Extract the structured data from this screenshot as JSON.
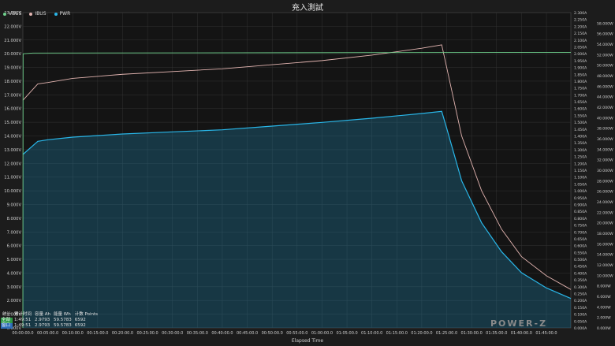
{
  "chart_data": {
    "type": "line",
    "title": "充入測試",
    "xlabel": "Elapsed Time",
    "x_ticks": [
      "00:00:00.0",
      "00:05:00.0",
      "00:10:00.0",
      "00:15:00.0",
      "00:20:00.0",
      "00:25:00.0",
      "00:30:00.0",
      "00:35:00.0",
      "00:40:00.0",
      "00:45:00.0",
      "00:50:00.0",
      "00:55:00.0",
      "01:00:00.0",
      "01:05:00.0",
      "01:10:00.0",
      "01:15:00.0",
      "01:20:00.0",
      "01:25:00.0",
      "01:30:00.0",
      "01:35:00.0",
      "01:40:00.0",
      "01:45:00.0"
    ],
    "x_unit": "minutes",
    "xlim": [
      0,
      109.9
    ],
    "y_left": {
      "name": "VBUS",
      "unit": "V",
      "ylim": [
        0,
        23
      ]
    },
    "y_mid": {
      "name": "IBUS",
      "unit": "A",
      "ylim": [
        0,
        2.3
      ]
    },
    "y_right": {
      "name": "PWR",
      "unit": "W",
      "ylim": [
        0,
        60
      ]
    },
    "legend": [
      "VBUS",
      "IBUS",
      "PWR"
    ],
    "legend_placement": "top-left",
    "grid": true,
    "series": [
      {
        "name": "VBUS",
        "unit": "V",
        "color": "#6fd08c",
        "x": [
          0,
          0.05,
          0.1,
          2,
          109.9
        ],
        "y": [
          0,
          20.0,
          20.0,
          20.05,
          20.1
        ]
      },
      {
        "name": "IBUS",
        "unit": "A",
        "color": "#e2b4b0",
        "x": [
          0,
          3,
          5,
          10,
          20,
          30,
          40,
          50,
          60,
          70,
          80,
          84,
          85,
          88,
          92,
          96,
          100,
          105,
          109.9
        ],
        "y": [
          1.66,
          1.78,
          1.79,
          1.82,
          1.85,
          1.87,
          1.89,
          1.92,
          1.95,
          1.99,
          2.04,
          2.065,
          1.9,
          1.4,
          1.0,
          0.72,
          0.52,
          0.38,
          0.28
        ]
      },
      {
        "name": "PWR",
        "unit": "W",
        "color": "#29b6e8",
        "x": [
          0,
          3,
          5,
          10,
          20,
          30,
          40,
          50,
          60,
          70,
          80,
          84,
          85,
          88,
          92,
          96,
          100,
          105,
          109.9
        ],
        "y": [
          33.0,
          35.5,
          35.8,
          36.3,
          36.9,
          37.3,
          37.7,
          38.4,
          39.1,
          39.9,
          40.8,
          41.2,
          38.0,
          28.0,
          20.0,
          14.5,
          10.5,
          7.6,
          5.6
        ]
      }
    ]
  },
  "stats": {
    "headers": [
      "统计",
      "累计时间",
      "容量 Ah",
      "能量 Wh",
      "计数 Points"
    ],
    "rows": [
      {
        "tag": "全部",
        "tag_color": "#2e9a47",
        "time": "1:49:51",
        "ah": "2.9793",
        "wh": "59.5783",
        "points": "6592"
      },
      {
        "tag": "窗口",
        "tag_color": "#2f6fb8",
        "time": "1:49:51",
        "ah": "2.9793",
        "wh": "59.5783",
        "points": "6592"
      }
    ]
  },
  "brand": "POWER-Z"
}
